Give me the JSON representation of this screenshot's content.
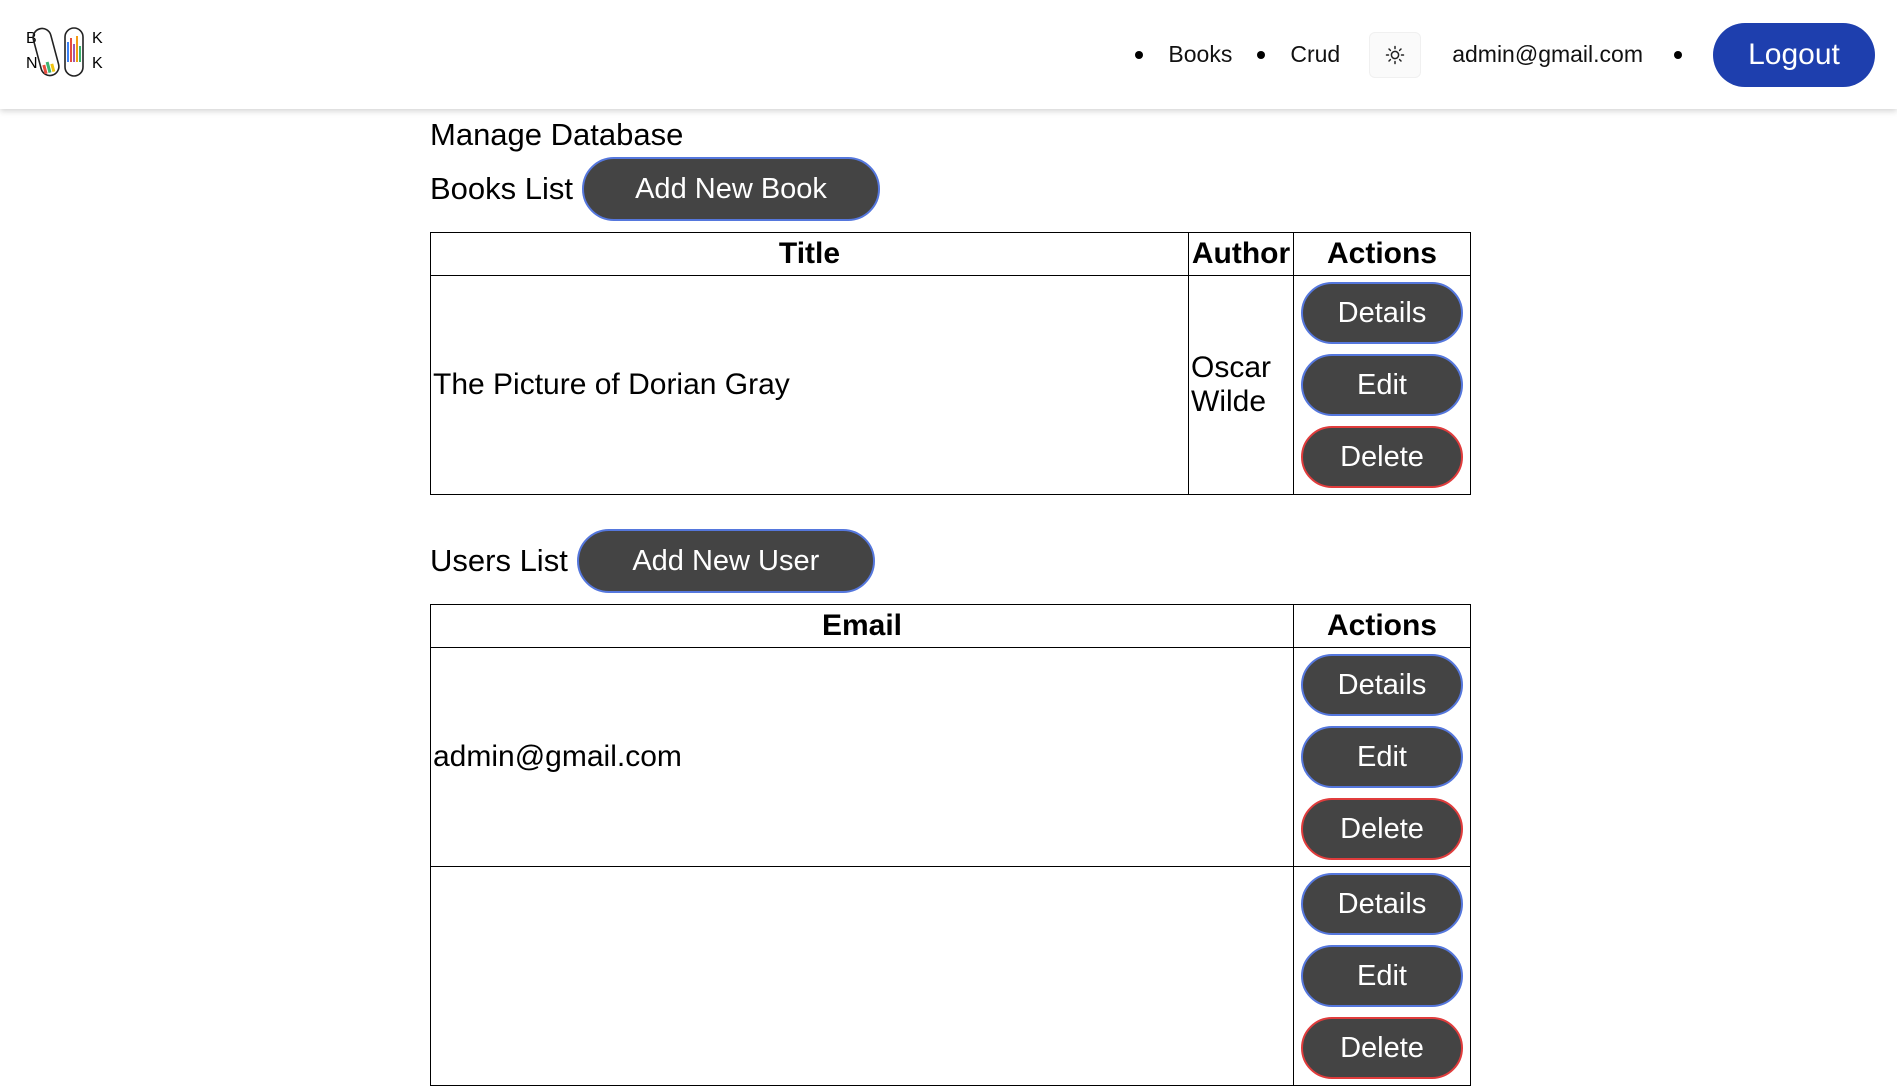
{
  "header": {
    "logo": {
      "letters": [
        "B",
        "N",
        "K",
        "K"
      ]
    },
    "nav": {
      "books_label": "Books",
      "crud_label": "Crud",
      "theme_icon": "sun-icon",
      "user_email": "admin@gmail.com",
      "logout_label": "Logout"
    }
  },
  "main": {
    "title": "Manage Database",
    "books": {
      "section_label": "Books List",
      "add_label": "Add New Book",
      "columns": [
        "Title",
        "Author",
        "Actions"
      ],
      "rows": [
        {
          "title": "The Picture of Dorian Gray",
          "author": "Oscar Wilde"
        }
      ]
    },
    "users": {
      "section_label": "Users List",
      "add_label": "Add New User",
      "columns": [
        "Email",
        "Actions"
      ],
      "rows": [
        {
          "email": "admin@gmail.com"
        },
        {
          "email": ""
        }
      ]
    },
    "actions": {
      "details": "Details",
      "edit": "Edit",
      "delete": "Delete"
    }
  },
  "colors": {
    "logout_bg": "#1e3fae",
    "button_bg": "#444444",
    "button_border": "#5577dd",
    "delete_border": "#e03c3c"
  }
}
